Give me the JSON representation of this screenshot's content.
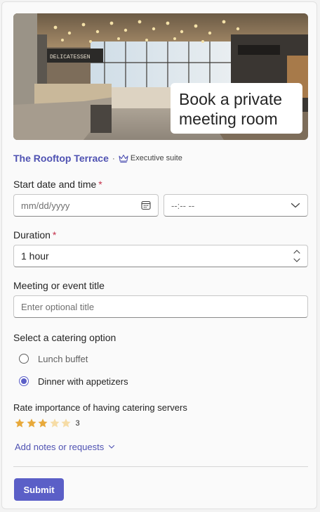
{
  "hero": {
    "caption_line1": "Book a private",
    "caption_line2": "meeting room",
    "sign_text": "DELICATESSEN"
  },
  "venue": {
    "name": "The Rooftop Terrace",
    "separator": "·",
    "tier_icon": "crown-icon",
    "tier": "Executive suite"
  },
  "start": {
    "label": "Start date and time",
    "required_mark": "*",
    "date_placeholder": "mm/dd/yyyy",
    "time_placeholder": "--:-- --"
  },
  "duration": {
    "label": "Duration",
    "required_mark": "*",
    "value": "1 hour"
  },
  "title_field": {
    "label": "Meeting or event  title",
    "placeholder": "Enter optional title"
  },
  "catering": {
    "label": "Select a catering option",
    "options": [
      {
        "label": "Lunch buffet",
        "selected": false
      },
      {
        "label": "Dinner with appetizers",
        "selected": true
      }
    ]
  },
  "rating": {
    "label": "Rate importance of having catering servers",
    "value": 3,
    "max": 5,
    "display": "3",
    "filled_color": "#e8a93a",
    "empty_color": "#f6dca6"
  },
  "notes": {
    "label": "Add notes or requests"
  },
  "actions": {
    "submit_label": "Submit"
  },
  "colors": {
    "accent": "#5b5fc7",
    "link": "#4f52b2",
    "required": "#c4314b"
  }
}
